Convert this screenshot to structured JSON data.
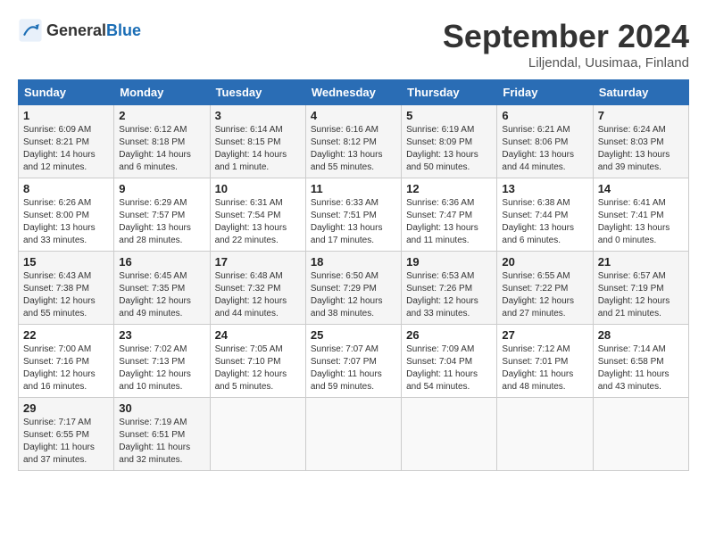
{
  "header": {
    "logo_general": "General",
    "logo_blue": "Blue",
    "month_title": "September 2024",
    "location": "Liljendal, Uusimaa, Finland"
  },
  "calendar": {
    "days_of_week": [
      "Sunday",
      "Monday",
      "Tuesday",
      "Wednesday",
      "Thursday",
      "Friday",
      "Saturday"
    ],
    "weeks": [
      [
        null,
        null,
        null,
        null,
        null,
        null,
        null
      ]
    ],
    "cells": [
      {
        "day": null,
        "info": ""
      },
      {
        "day": null,
        "info": ""
      },
      {
        "day": null,
        "info": ""
      },
      {
        "day": null,
        "info": ""
      },
      {
        "day": null,
        "info": ""
      },
      {
        "day": null,
        "info": ""
      },
      {
        "day": null,
        "info": ""
      }
    ]
  },
  "days": [
    {
      "week": 1,
      "cells": [
        {
          "num": "1",
          "sunrise": "6:09 AM",
          "sunset": "8:21 PM",
          "daylight": "14 hours and 12 minutes."
        },
        {
          "num": "2",
          "sunrise": "6:12 AM",
          "sunset": "8:18 PM",
          "daylight": "14 hours and 6 minutes."
        },
        {
          "num": "3",
          "sunrise": "6:14 AM",
          "sunset": "8:15 PM",
          "daylight": "14 hours and 1 minute."
        },
        {
          "num": "4",
          "sunrise": "6:16 AM",
          "sunset": "8:12 PM",
          "daylight": "13 hours and 55 minutes."
        },
        {
          "num": "5",
          "sunrise": "6:19 AM",
          "sunset": "8:09 PM",
          "daylight": "13 hours and 50 minutes."
        },
        {
          "num": "6",
          "sunrise": "6:21 AM",
          "sunset": "8:06 PM",
          "daylight": "13 hours and 44 minutes."
        },
        {
          "num": "7",
          "sunrise": "6:24 AM",
          "sunset": "8:03 PM",
          "daylight": "13 hours and 39 minutes."
        }
      ]
    },
    {
      "week": 2,
      "cells": [
        {
          "num": "8",
          "sunrise": "6:26 AM",
          "sunset": "8:00 PM",
          "daylight": "13 hours and 33 minutes."
        },
        {
          "num": "9",
          "sunrise": "6:29 AM",
          "sunset": "7:57 PM",
          "daylight": "13 hours and 28 minutes."
        },
        {
          "num": "10",
          "sunrise": "6:31 AM",
          "sunset": "7:54 PM",
          "daylight": "13 hours and 22 minutes."
        },
        {
          "num": "11",
          "sunrise": "6:33 AM",
          "sunset": "7:51 PM",
          "daylight": "13 hours and 17 minutes."
        },
        {
          "num": "12",
          "sunrise": "6:36 AM",
          "sunset": "7:47 PM",
          "daylight": "13 hours and 11 minutes."
        },
        {
          "num": "13",
          "sunrise": "6:38 AM",
          "sunset": "7:44 PM",
          "daylight": "13 hours and 6 minutes."
        },
        {
          "num": "14",
          "sunrise": "6:41 AM",
          "sunset": "7:41 PM",
          "daylight": "13 hours and 0 minutes."
        }
      ]
    },
    {
      "week": 3,
      "cells": [
        {
          "num": "15",
          "sunrise": "6:43 AM",
          "sunset": "7:38 PM",
          "daylight": "12 hours and 55 minutes."
        },
        {
          "num": "16",
          "sunrise": "6:45 AM",
          "sunset": "7:35 PM",
          "daylight": "12 hours and 49 minutes."
        },
        {
          "num": "17",
          "sunrise": "6:48 AM",
          "sunset": "7:32 PM",
          "daylight": "12 hours and 44 minutes."
        },
        {
          "num": "18",
          "sunrise": "6:50 AM",
          "sunset": "7:29 PM",
          "daylight": "12 hours and 38 minutes."
        },
        {
          "num": "19",
          "sunrise": "6:53 AM",
          "sunset": "7:26 PM",
          "daylight": "12 hours and 33 minutes."
        },
        {
          "num": "20",
          "sunrise": "6:55 AM",
          "sunset": "7:22 PM",
          "daylight": "12 hours and 27 minutes."
        },
        {
          "num": "21",
          "sunrise": "6:57 AM",
          "sunset": "7:19 PM",
          "daylight": "12 hours and 21 minutes."
        }
      ]
    },
    {
      "week": 4,
      "cells": [
        {
          "num": "22",
          "sunrise": "7:00 AM",
          "sunset": "7:16 PM",
          "daylight": "12 hours and 16 minutes."
        },
        {
          "num": "23",
          "sunrise": "7:02 AM",
          "sunset": "7:13 PM",
          "daylight": "12 hours and 10 minutes."
        },
        {
          "num": "24",
          "sunrise": "7:05 AM",
          "sunset": "7:10 PM",
          "daylight": "12 hours and 5 minutes."
        },
        {
          "num": "25",
          "sunrise": "7:07 AM",
          "sunset": "7:07 PM",
          "daylight": "11 hours and 59 minutes."
        },
        {
          "num": "26",
          "sunrise": "7:09 AM",
          "sunset": "7:04 PM",
          "daylight": "11 hours and 54 minutes."
        },
        {
          "num": "27",
          "sunrise": "7:12 AM",
          "sunset": "7:01 PM",
          "daylight": "11 hours and 48 minutes."
        },
        {
          "num": "28",
          "sunrise": "7:14 AM",
          "sunset": "6:58 PM",
          "daylight": "11 hours and 43 minutes."
        }
      ]
    },
    {
      "week": 5,
      "cells": [
        {
          "num": "29",
          "sunrise": "7:17 AM",
          "sunset": "6:55 PM",
          "daylight": "11 hours and 37 minutes."
        },
        {
          "num": "30",
          "sunrise": "7:19 AM",
          "sunset": "6:51 PM",
          "daylight": "11 hours and 32 minutes."
        },
        {
          "num": null
        },
        {
          "num": null
        },
        {
          "num": null
        },
        {
          "num": null
        },
        {
          "num": null
        }
      ]
    }
  ],
  "labels": {
    "sunrise": "Sunrise:",
    "sunset": "Sunset:",
    "daylight": "Daylight:"
  }
}
